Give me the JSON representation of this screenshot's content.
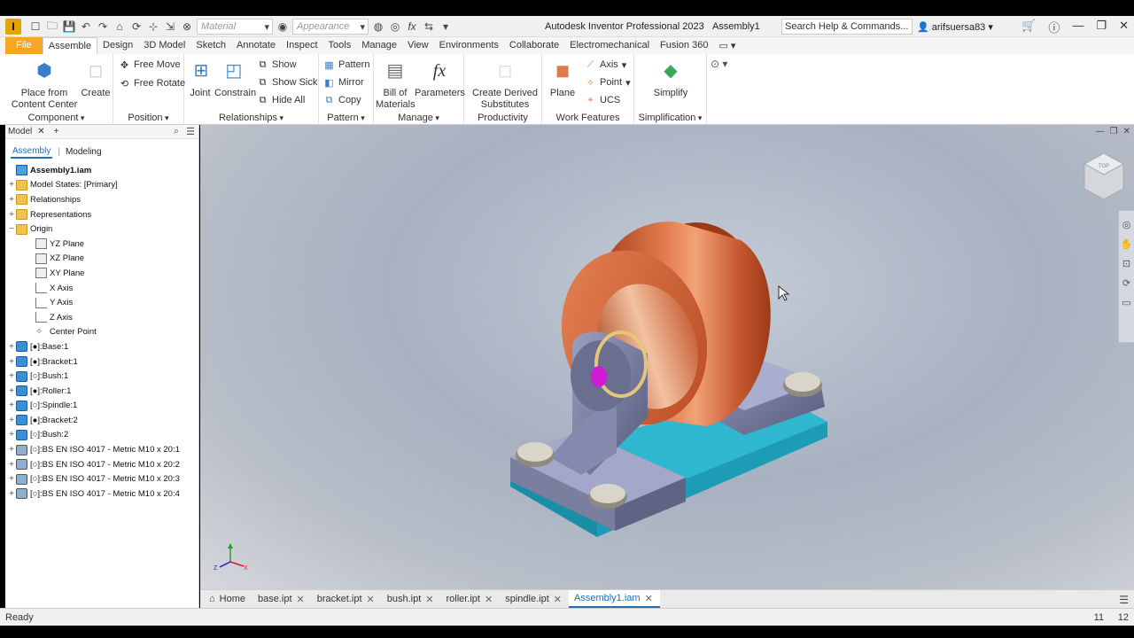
{
  "titlebar": {
    "app_icon": "I",
    "material_placeholder": "Material",
    "appearance_placeholder": "Appearance",
    "fx_label": "fx",
    "app_title": "Autodesk Inventor Professional 2023",
    "doc_title": "Assembly1",
    "search_label": "Search Help & Commands...",
    "user": "arifsuersa83"
  },
  "tabs": [
    "File",
    "Assemble",
    "Design",
    "3D Model",
    "Sketch",
    "Annotate",
    "Inspect",
    "Tools",
    "Manage",
    "View",
    "Environments",
    "Collaborate",
    "Electromechanical",
    "Fusion 360"
  ],
  "ribbon": {
    "component": {
      "label": "Component",
      "place": "Place from Content Center",
      "create": "Create"
    },
    "position": {
      "label": "Position",
      "free_move": "Free Move",
      "free_rotate": "Free Rotate"
    },
    "relationships": {
      "label": "Relationships",
      "joint": "Joint",
      "constrain": "Constrain",
      "show": "Show",
      "show_sick": "Show Sick",
      "hide_all": "Hide All"
    },
    "pattern": {
      "label": "Pattern",
      "pattern": "Pattern",
      "mirror": "Mirror",
      "copy": "Copy"
    },
    "manage": {
      "label": "Manage",
      "bom": "Bill of Materials",
      "parameters": "Parameters",
      "fx": "fx"
    },
    "productivity": {
      "label": "Productivity",
      "derived": "Create Derived Substitutes"
    },
    "work_features": {
      "label": "Work Features",
      "plane": "Plane",
      "axis": "Axis",
      "point": "Point",
      "ucs": "UCS"
    },
    "simplification": {
      "label": "Simplification",
      "simplify": "Simplify"
    }
  },
  "browser": {
    "title": "Model",
    "tab_assembly": "Assembly",
    "tab_modeling": "Modeling",
    "tree": [
      {
        "label": "Assembly1.iam",
        "icon": "asm",
        "level": 0,
        "exp": "",
        "bold": true
      },
      {
        "label": "Model States: [Primary]",
        "icon": "folder",
        "level": 0,
        "exp": "+"
      },
      {
        "label": "Relationships",
        "icon": "folder",
        "level": 0,
        "exp": "+"
      },
      {
        "label": "Representations",
        "icon": "folder",
        "level": 0,
        "exp": "+"
      },
      {
        "label": "Origin",
        "icon": "folder",
        "level": 0,
        "exp": "−"
      },
      {
        "label": "YZ Plane",
        "icon": "plane",
        "level": 1,
        "exp": ""
      },
      {
        "label": "XZ Plane",
        "icon": "plane",
        "level": 1,
        "exp": ""
      },
      {
        "label": "XY Plane",
        "icon": "plane",
        "level": 1,
        "exp": ""
      },
      {
        "label": "X Axis",
        "icon": "axis",
        "level": 1,
        "exp": ""
      },
      {
        "label": "Y Axis",
        "icon": "axis",
        "level": 1,
        "exp": ""
      },
      {
        "label": "Z Axis",
        "icon": "axis",
        "level": 1,
        "exp": ""
      },
      {
        "label": "Center Point",
        "icon": "point",
        "level": 1,
        "exp": ""
      },
      {
        "label": "[●]:Base:1",
        "icon": "part",
        "level": 0,
        "exp": "+"
      },
      {
        "label": "[●]:Bracket:1",
        "icon": "part",
        "level": 0,
        "exp": "+"
      },
      {
        "label": "[○]:Bush:1",
        "icon": "part",
        "level": 0,
        "exp": "+"
      },
      {
        "label": "[●]:Roller:1",
        "icon": "part",
        "level": 0,
        "exp": "+"
      },
      {
        "label": "[○]:Spindle:1",
        "icon": "part",
        "level": 0,
        "exp": "+"
      },
      {
        "label": "[●]:Bracket:2",
        "icon": "part",
        "level": 0,
        "exp": "+"
      },
      {
        "label": "[○]:Bush:2",
        "icon": "part",
        "level": 0,
        "exp": "+"
      },
      {
        "label": "[○]:BS EN ISO 4017 - Metric M10 x 20:1",
        "icon": "bolt",
        "level": 0,
        "exp": "+"
      },
      {
        "label": "[○]:BS EN ISO 4017 - Metric M10 x 20:2",
        "icon": "bolt",
        "level": 0,
        "exp": "+"
      },
      {
        "label": "[○]:BS EN ISO 4017 - Metric M10 x 20:3",
        "icon": "bolt",
        "level": 0,
        "exp": "+"
      },
      {
        "label": "[○]:BS EN ISO 4017 - Metric M10 x 20:4",
        "icon": "bolt",
        "level": 0,
        "exp": "+"
      }
    ]
  },
  "viewport": {
    "viewcube_face": "TOP",
    "triad": {
      "x": "X",
      "y": "Y",
      "z": "Z"
    }
  },
  "doc_tabs": [
    {
      "label": "Home",
      "active": false,
      "closable": false
    },
    {
      "label": "base.ipt",
      "active": false,
      "closable": true
    },
    {
      "label": "bracket.ipt",
      "active": false,
      "closable": true
    },
    {
      "label": "bush.ipt",
      "active": false,
      "closable": true
    },
    {
      "label": "roller.ipt",
      "active": false,
      "closable": true
    },
    {
      "label": "spindle.ipt",
      "active": false,
      "closable": true
    },
    {
      "label": "Assembly1.iam",
      "active": true,
      "closable": true
    }
  ],
  "status": {
    "text": "Ready",
    "num1": "11",
    "num2": "12"
  },
  "colors": {
    "accent": "#1f6fb5",
    "file_tab": "#f5a623",
    "roller": "#d4613a",
    "base": "#22a9c4",
    "bracket": "#7a7f9e"
  }
}
